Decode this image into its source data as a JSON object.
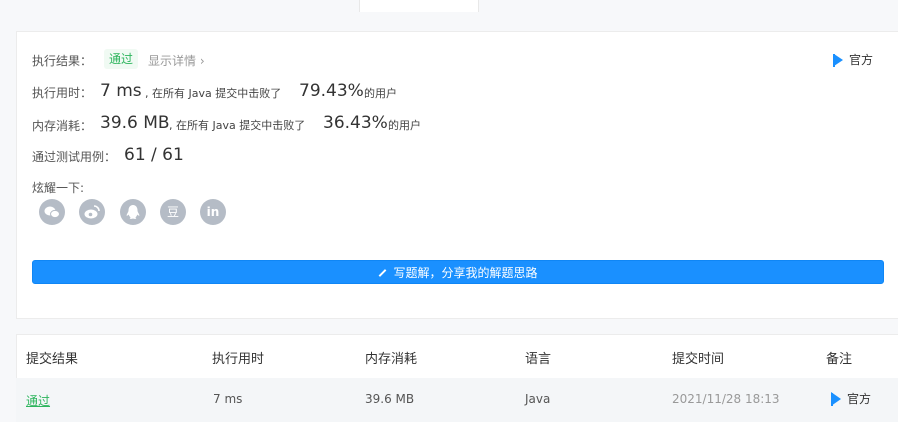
{
  "result": {
    "status_label": "执行结果：",
    "status": "通过",
    "show_details": "显示详情",
    "official": "官方"
  },
  "runtime": {
    "label": "执行用时：",
    "value": "7 ms",
    "prefix": ", 在所有 Java 提交中击败了",
    "percent": "79.43%",
    "suffix": "的用户"
  },
  "memory": {
    "label": "内存消耗：",
    "value": "39.6 MB",
    "prefix": ", 在所有 Java 提交中击败了",
    "percent": "36.43%",
    "suffix": "的用户"
  },
  "tests": {
    "label": "通过测试用例：",
    "value": "61 / 61"
  },
  "share": {
    "label": "炫耀一下:",
    "icons": [
      "wechat-icon",
      "weibo-icon",
      "qq-icon",
      "douban-icon",
      "linkedin-icon"
    ],
    "douban_glyph": "豆",
    "linkedin_glyph": "in"
  },
  "solution_button": "写题解，分享我的解题思路",
  "submissions": {
    "headers": [
      "提交结果",
      "执行用时",
      "内存消耗",
      "语言",
      "提交时间",
      "备注"
    ],
    "rows": [
      {
        "result": "通过",
        "runtime": "7 ms",
        "memory": "39.6 MB",
        "language": "Java",
        "time": "2021/11/28 18:13",
        "note": "官方"
      }
    ]
  },
  "colors": {
    "accent": "#1a90ff",
    "success": "#2db55d",
    "muted": "#999999"
  }
}
